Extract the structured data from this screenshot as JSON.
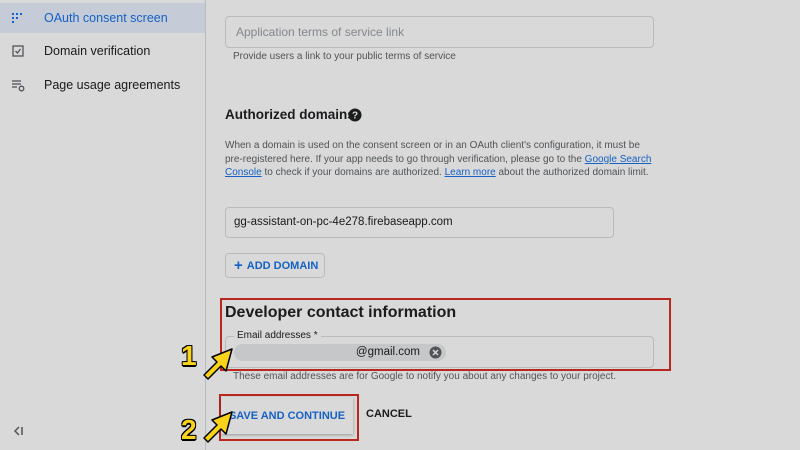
{
  "sidebar": {
    "items": [
      {
        "label": "OAuth consent screen",
        "icon": "oauth-grid-icon",
        "active": true
      },
      {
        "label": "Domain verification",
        "icon": "domain-check-icon",
        "active": false
      },
      {
        "label": "Page usage agreements",
        "icon": "settings-list-icon",
        "active": false
      }
    ],
    "collapse_icon": "collapse-sidebar-icon"
  },
  "terms": {
    "placeholder": "Application terms of service link",
    "helper": "Provide users a link to your public terms of service"
  },
  "authorized_domains": {
    "title": "Authorized domains",
    "description_part1": "When a domain is used on the consent screen or in an OAuth client's configuration, it must be pre-registered here. If your app needs to go through verification, please go to the ",
    "link_search_console": "Google Search Console",
    "description_part2": " to check if your domains are authorized. ",
    "link_learn_more": "Learn more",
    "description_part3": " about the authorized domain limit.",
    "domain_value": "gg-assistant-on-pc-4e278.firebaseapp.com",
    "add_button": "ADD DOMAIN"
  },
  "developer_contact": {
    "title": "Developer contact information",
    "email_label": "Email addresses *",
    "email_chip": "@gmail.com",
    "helper": "These email addresses are for Google to notify you about any changes to your project."
  },
  "actions": {
    "save": "SAVE AND CONTINUE",
    "cancel": "CANCEL"
  },
  "annotations": {
    "step1": "1",
    "step2": "2",
    "highlight_color": "#d93025",
    "arrow_color": "#f9d21b"
  }
}
